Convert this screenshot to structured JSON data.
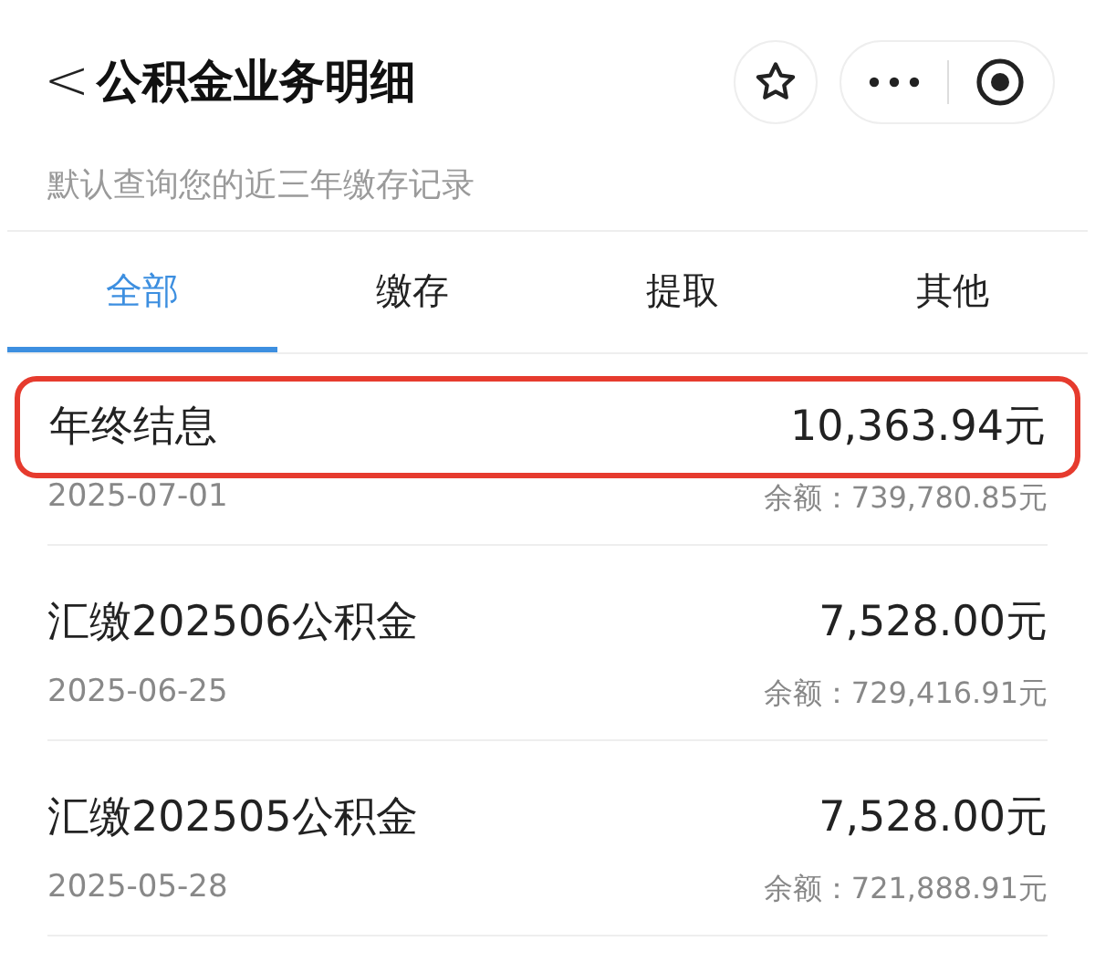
{
  "header": {
    "back": "<",
    "title": "公积金业务明细"
  },
  "subtitle": "默认查询您的近三年缴存记录",
  "tabs": [
    {
      "label": "全部",
      "selected": true
    },
    {
      "label": "缴存",
      "selected": false
    },
    {
      "label": "提取",
      "selected": false
    },
    {
      "label": "其他",
      "selected": false
    }
  ],
  "records": [
    {
      "title": "年终结息",
      "amount": "10,363.94元",
      "date": "2025-07-01",
      "balance": "余额：739,780.85元",
      "highlighted": true
    },
    {
      "title": "汇缴202506公积金",
      "amount": "7,528.00元",
      "date": "2025-06-25",
      "balance": "余额：729,416.91元",
      "highlighted": false
    },
    {
      "title": "汇缴202505公积金",
      "amount": "7,528.00元",
      "date": "2025-05-28",
      "balance": "余额：721,888.91元",
      "highlighted": false
    }
  ]
}
